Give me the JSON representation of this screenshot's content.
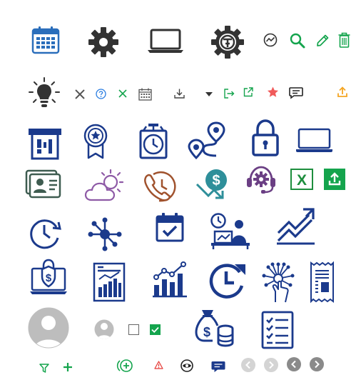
{
  "colors": {
    "navy": "#1B3A8C",
    "calendar_blue": "#2A6EBB",
    "dark": "#333333",
    "green": "#14A44D",
    "excel_green": "#1E8E3E",
    "orange": "#F5A623",
    "red": "#E53935",
    "brown": "#A0522D",
    "purple": "#6B3F84",
    "teal": "#2E8F9A",
    "grey": "#888888",
    "light_grey": "#CCCCCC"
  },
  "icons": [
    "calendar-icon",
    "gear-icon",
    "laptop-icon",
    "gear-settings-icon",
    "trend-circle-icon",
    "search-icon",
    "pencil-icon",
    "trash-icon",
    "lightbulb-icon",
    "close-icon",
    "help-icon",
    "close-green-icon",
    "calendar-small-icon",
    "download-icon",
    "caret-down-icon",
    "sign-out-icon",
    "external-link-icon",
    "star-icon",
    "comment-icon",
    "upload-icon",
    "atm-icon",
    "award-badge-icon",
    "stopwatch-icon",
    "route-icon",
    "lock-icon",
    "laptop-outline-icon",
    "contact-card-icon",
    "weather-icon",
    "phone-clock-icon",
    "dollar-down-icon",
    "support-agent-icon",
    "excel-icon",
    "upload-box-icon",
    "history-icon",
    "network-icon",
    "calendar-check-icon",
    "time-worker-icon",
    "growth-chart-icon",
    "secure-laptop-icon",
    "report-chart-icon",
    "bar-growth-icon",
    "refresh-clock-icon",
    "idea-hand-icon",
    "receipt-icon",
    "avatar-large",
    "avatar-small",
    "checkbox-unchecked",
    "checkbox-checked",
    "money-bag-icon",
    "checklist-icon",
    "filter-icon",
    "plus-icon",
    "add-circle-icon",
    "warning-icon",
    "eye-icon",
    "chat-icon",
    "chevron-left-light-icon",
    "chevron-right-light-icon",
    "chevron-left-dark-icon",
    "chevron-right-dark-icon"
  ]
}
